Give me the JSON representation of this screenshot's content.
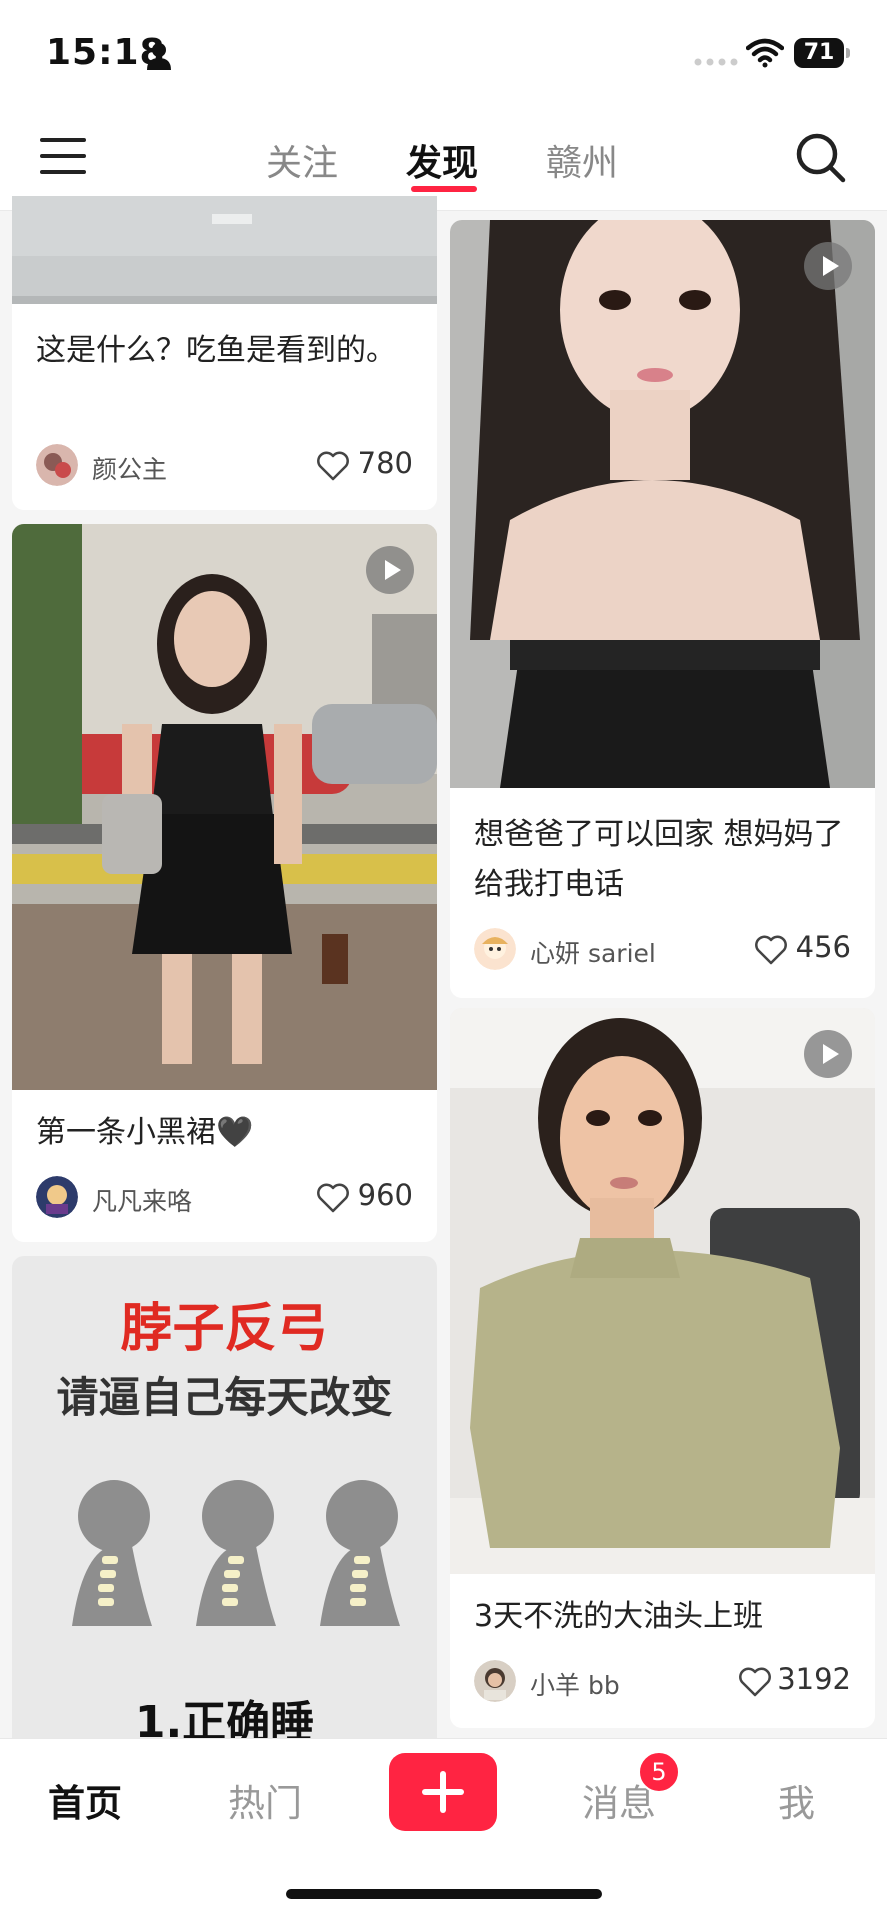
{
  "status_bar": {
    "time": "15:18",
    "battery": "71"
  },
  "nav": {
    "tabs": [
      "关注",
      "发现",
      "赣州"
    ],
    "active_tab": "发现"
  },
  "feed": {
    "left": [
      {
        "title": "这是什么？吃鱼是看到的。",
        "author": "颜公主",
        "likes": "780",
        "has_video": false
      },
      {
        "title": "第一条小黑裙🖤",
        "author": "凡凡来咯",
        "likes": "960",
        "has_video": true
      },
      {
        "image_text": {
          "headline": "脖子反弓",
          "subhead": "请逼自己每天改变",
          "footer": "1.正确睡"
        }
      }
    ],
    "right": [
      {
        "title": "想爸爸了可以回家 想妈妈了给我打电话",
        "author": "心妍 sariel",
        "likes": "456",
        "has_video": true
      },
      {
        "title": "3天不洗的大油头上班",
        "author": "小羊 bb",
        "likes": "3192",
        "has_video": true
      }
    ]
  },
  "tabbar": {
    "items": [
      "首页",
      "热门",
      "消息",
      "我"
    ],
    "active": "首页",
    "messages_badge": "5"
  },
  "colors": {
    "accent": "#ff2442",
    "background": "#f5f5f5"
  }
}
